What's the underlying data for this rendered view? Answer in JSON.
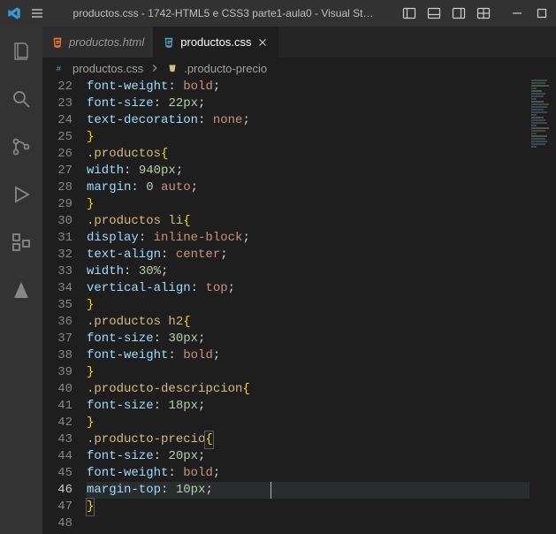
{
  "window": {
    "title": "productos.css - 1742-HTML5 e CSS3 parte1-aula0 - Visual St…"
  },
  "tabs": [
    {
      "label": "productos.html",
      "active": false,
      "type": "html"
    },
    {
      "label": "productos.css",
      "active": true,
      "type": "css",
      "closable": true
    }
  ],
  "breadcrumb": {
    "file": "productos.css",
    "symbol": ".producto-precio"
  },
  "gutter": {
    "start": 22,
    "end": 48,
    "current": 46
  },
  "code": [
    {
      "n": 22,
      "indent": 8,
      "tokens": [
        [
          "prop",
          "font-weight"
        ],
        [
          "punc",
          ": "
        ],
        [
          "kw",
          "bold"
        ],
        [
          "punc",
          ";"
        ]
      ]
    },
    {
      "n": 23,
      "indent": 8,
      "tokens": [
        [
          "prop",
          "font-size"
        ],
        [
          "punc",
          ": "
        ],
        [
          "num",
          "22px"
        ],
        [
          "punc",
          ";"
        ]
      ]
    },
    {
      "n": 24,
      "indent": 8,
      "tokens": [
        [
          "prop",
          "text-decoration"
        ],
        [
          "punc",
          ": "
        ],
        [
          "kw",
          "none"
        ],
        [
          "punc",
          ";"
        ]
      ]
    },
    {
      "n": 25,
      "indent": 0,
      "tokens": [
        [
          "brace",
          "}"
        ]
      ]
    },
    {
      "n": 26,
      "indent": 0,
      "tokens": [
        [
          "sel",
          ".productos"
        ],
        [
          "brace",
          "{"
        ]
      ]
    },
    {
      "n": 27,
      "indent": 8,
      "tokens": [
        [
          "prop",
          "width"
        ],
        [
          "punc",
          ": "
        ],
        [
          "num",
          "940px"
        ],
        [
          "punc",
          ";"
        ]
      ]
    },
    {
      "n": 28,
      "indent": 8,
      "tokens": [
        [
          "prop",
          "margin"
        ],
        [
          "punc",
          ": "
        ],
        [
          "num",
          "0"
        ],
        [
          "punc",
          " "
        ],
        [
          "kw",
          "auto"
        ],
        [
          "punc",
          ";"
        ]
      ]
    },
    {
      "n": 29,
      "indent": 0,
      "tokens": [
        [
          "brace",
          "}"
        ]
      ]
    },
    {
      "n": 30,
      "indent": 0,
      "tokens": [
        [
          "sel",
          ".productos li"
        ],
        [
          "brace",
          "{"
        ]
      ]
    },
    {
      "n": 31,
      "indent": 8,
      "tokens": [
        [
          "prop",
          "display"
        ],
        [
          "punc",
          ": "
        ],
        [
          "kw",
          "inline-block"
        ],
        [
          "punc",
          ";"
        ]
      ]
    },
    {
      "n": 32,
      "indent": 8,
      "tokens": [
        [
          "prop",
          "text-align"
        ],
        [
          "punc",
          ": "
        ],
        [
          "kw",
          "center"
        ],
        [
          "punc",
          ";"
        ]
      ]
    },
    {
      "n": 33,
      "indent": 8,
      "tokens": [
        [
          "prop",
          "width"
        ],
        [
          "punc",
          ": "
        ],
        [
          "num",
          "30%"
        ],
        [
          "punc",
          ";"
        ]
      ]
    },
    {
      "n": 34,
      "indent": 8,
      "tokens": [
        [
          "prop",
          "vertical-align"
        ],
        [
          "punc",
          ": "
        ],
        [
          "kw",
          "top"
        ],
        [
          "punc",
          ";"
        ]
      ]
    },
    {
      "n": 35,
      "indent": 0,
      "tokens": [
        [
          "brace",
          "}"
        ]
      ]
    },
    {
      "n": 36,
      "indent": 0,
      "tokens": [
        [
          "sel",
          ".productos h2"
        ],
        [
          "brace",
          "{"
        ]
      ]
    },
    {
      "n": 37,
      "indent": 8,
      "tokens": [
        [
          "prop",
          "font-size"
        ],
        [
          "punc",
          ": "
        ],
        [
          "num",
          "30px"
        ],
        [
          "punc",
          ";"
        ]
      ]
    },
    {
      "n": 38,
      "indent": 8,
      "tokens": [
        [
          "prop",
          "font-weight"
        ],
        [
          "punc",
          ": "
        ],
        [
          "kw",
          "bold"
        ],
        [
          "punc",
          ";"
        ]
      ]
    },
    {
      "n": 39,
      "indent": 0,
      "tokens": [
        [
          "brace",
          "}"
        ]
      ]
    },
    {
      "n": 40,
      "indent": 0,
      "tokens": [
        [
          "sel",
          ".producto-descripcion"
        ],
        [
          "brace",
          "{"
        ]
      ]
    },
    {
      "n": 41,
      "indent": 8,
      "tokens": [
        [
          "prop",
          "font-size"
        ],
        [
          "punc",
          ": "
        ],
        [
          "num",
          "18px"
        ],
        [
          "punc",
          ";"
        ]
      ]
    },
    {
      "n": 42,
      "indent": 0,
      "tokens": [
        [
          "brace",
          "}"
        ]
      ]
    },
    {
      "n": 43,
      "indent": 0,
      "tokens": [
        [
          "sel",
          ".producto-precio"
        ],
        [
          "brace",
          "{"
        ]
      ],
      "match_open": true
    },
    {
      "n": 44,
      "indent": 8,
      "tokens": [
        [
          "prop",
          "font-size"
        ],
        [
          "punc",
          ": "
        ],
        [
          "num",
          "20px"
        ],
        [
          "punc",
          ";"
        ]
      ]
    },
    {
      "n": 45,
      "indent": 8,
      "tokens": [
        [
          "prop",
          "font-weight"
        ],
        [
          "punc",
          ": "
        ],
        [
          "kw",
          "bold"
        ],
        [
          "punc",
          ";"
        ]
      ]
    },
    {
      "n": 46,
      "indent": 8,
      "tokens": [
        [
          "prop",
          "margin-top"
        ],
        [
          "punc",
          ": "
        ],
        [
          "num",
          "10px"
        ],
        [
          "punc",
          ";"
        ]
      ],
      "current": true,
      "cursor_after_char": 15
    },
    {
      "n": 47,
      "indent": 0,
      "tokens": [
        [
          "brace",
          "}"
        ]
      ],
      "match_close": true
    },
    {
      "n": 48,
      "indent": 0,
      "tokens": []
    }
  ]
}
